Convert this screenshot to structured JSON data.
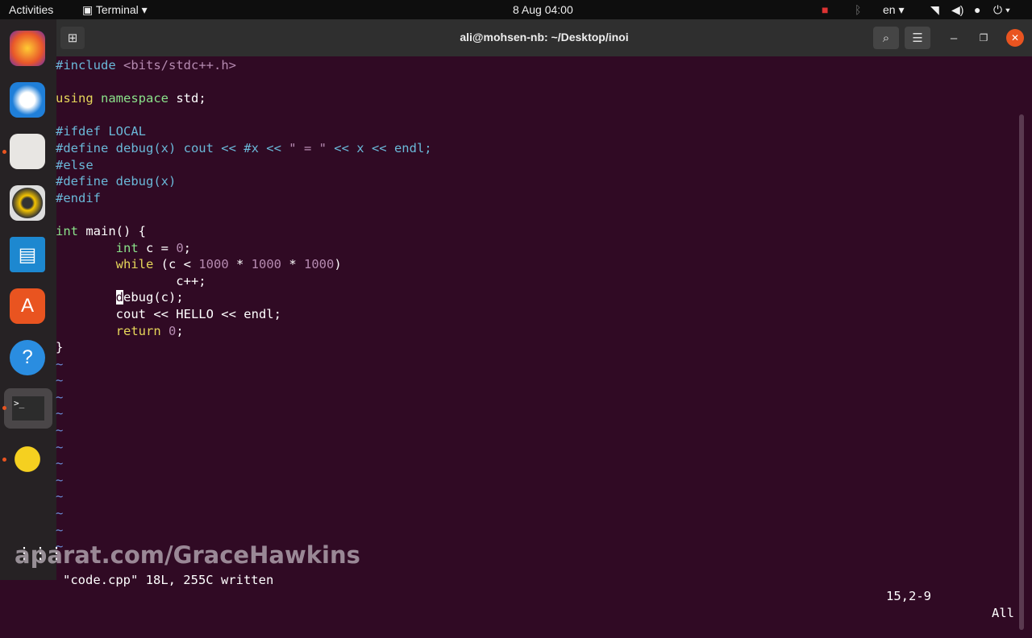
{
  "topbar": {
    "activities": "Activities",
    "app": "Terminal",
    "clock": "8 Aug  04:00",
    "lang": "en"
  },
  "dock": [
    "firefox-icon",
    "thunderbird-icon",
    "files-icon",
    "rhythmbox-icon",
    "libreoffice-writer-icon",
    "app-center-icon",
    "help-icon",
    "terminal-icon",
    "teapot-icon"
  ],
  "window": {
    "title": "ali@mohsen-nb: ~/Desktop/inoi"
  },
  "editor": {
    "lines": [
      [
        [
          "#include ",
          "pp"
        ],
        [
          "<bits/stdc++.h>",
          "str"
        ]
      ],
      [],
      [
        [
          "using",
          "kw"
        ],
        [
          " ",
          "tx"
        ],
        [
          "namespace",
          "ty"
        ],
        [
          " std;",
          "tx"
        ]
      ],
      [],
      [
        [
          "#ifdef LOCAL",
          "pp"
        ]
      ],
      [
        [
          "#define debug(x) cout << #x << ",
          "pp"
        ],
        [
          "\" = \"",
          "str"
        ],
        [
          " << x << endl;",
          "pp"
        ]
      ],
      [
        [
          "#else",
          "pp"
        ]
      ],
      [
        [
          "#define debug(x)",
          "pp"
        ]
      ],
      [
        [
          "#endif",
          "pp"
        ]
      ],
      [],
      [
        [
          "int",
          "ty"
        ],
        [
          " main() {",
          "tx"
        ]
      ],
      [
        [
          "        ",
          "tx"
        ],
        [
          "int",
          "ty"
        ],
        [
          " c = ",
          "tx"
        ],
        [
          "0",
          "num"
        ],
        [
          ";",
          "tx"
        ]
      ],
      [
        [
          "        ",
          "tx"
        ],
        [
          "while",
          "kw"
        ],
        [
          " (c < ",
          "tx"
        ],
        [
          "1000",
          "num"
        ],
        [
          " * ",
          "tx"
        ],
        [
          "1000",
          "num"
        ],
        [
          " * ",
          "tx"
        ],
        [
          "1000",
          "num"
        ],
        [
          ")",
          "tx"
        ]
      ],
      [
        [
          "                c++;",
          "tx"
        ]
      ],
      [
        [
          "        ",
          "tx"
        ],
        [
          "d",
          "cur"
        ],
        [
          "ebug(c);",
          "tx"
        ]
      ],
      [
        [
          "        cout << HELLO << endl;",
          "tx"
        ]
      ],
      [
        [
          "        ",
          "tx"
        ],
        [
          "return",
          "kw"
        ],
        [
          " ",
          "tx"
        ],
        [
          "0",
          "num"
        ],
        [
          ";",
          "tx"
        ]
      ],
      [
        [
          "}",
          "tx"
        ]
      ]
    ],
    "tilde": "~",
    "tilde_count": 12,
    "status_msg": "\"code.cpp\" 18L, 255C written",
    "position": "15,2-9",
    "scroll": "All"
  },
  "watermark": "aparat.com/GraceHawkins"
}
